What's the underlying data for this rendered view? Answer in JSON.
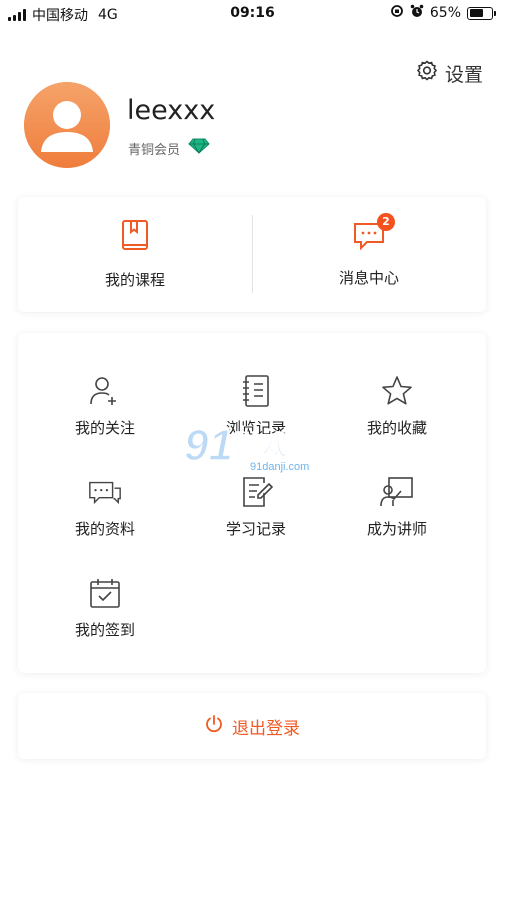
{
  "status_bar": {
    "carrier": "中国移动",
    "network": "4G",
    "time": "09:16",
    "battery": "65%",
    "battery_level": 0.65
  },
  "settings": {
    "label": "设置",
    "icon": "gear-icon"
  },
  "profile": {
    "username": "leexxx",
    "member_level": "青铜会员",
    "avatar_color": "#f08a4b",
    "badge_color": "#1db584"
  },
  "quick_links": [
    {
      "label": "我的课程",
      "icon": "bookmark-book-icon"
    },
    {
      "label": "消息中心",
      "icon": "message-bubble-icon",
      "badge": "2"
    }
  ],
  "menu": [
    {
      "label": "我的关注",
      "icon": "user-add-icon"
    },
    {
      "label": "浏览记录",
      "icon": "notebook-icon"
    },
    {
      "label": "我的收藏",
      "icon": "star-icon"
    },
    {
      "label": "我的资料",
      "icon": "chat-icon"
    },
    {
      "label": "学习记录",
      "icon": "document-edit-icon"
    },
    {
      "label": "成为讲师",
      "icon": "teacher-board-icon"
    },
    {
      "label": "我的签到",
      "icon": "calendar-check-icon"
    }
  ],
  "logout": {
    "label": "退出登录",
    "icon": "power-icon"
  },
  "colors": {
    "accent": "#f05a24",
    "text": "#222222",
    "muted": "#666666"
  },
  "watermark": {
    "text": "91游戏",
    "url_text": "91danji.com"
  }
}
